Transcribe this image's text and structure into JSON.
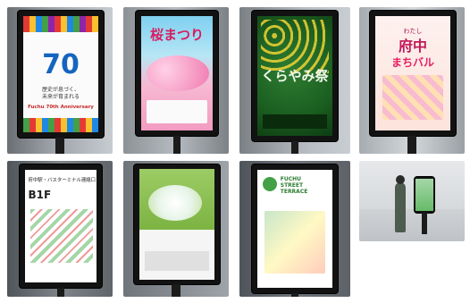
{
  "photos": [
    {
      "subject": "Fuchu 70th Anniversary poster",
      "big_number": "70",
      "jp_line1": "歴史が息づく、",
      "jp_line2": "未来が育まれる",
      "en_title": "Fuchu 70th Anniversary"
    },
    {
      "subject": "Sakura festival poster",
      "headline": "桜まつり"
    },
    {
      "subject": "Kurayami festival poster",
      "headline": "くらやみ祭"
    },
    {
      "subject": "Machi-bal poster",
      "headline_top": "わたし",
      "headline_main": "府中",
      "headline_bottom": "まちバル"
    },
    {
      "subject": "Bus terminal connection map",
      "title_line": "府中駅・バスターミナル連絡口",
      "floor": "B1F"
    },
    {
      "subject": "Hydrangea flower photo poster"
    },
    {
      "subject": "Fuchu Street Terrace poster",
      "brand_line1": "FUCHU",
      "brand_line2": "STREET",
      "brand_line3": "TERRACE"
    },
    {
      "subject": "Person using a digital signage kiosk"
    }
  ]
}
